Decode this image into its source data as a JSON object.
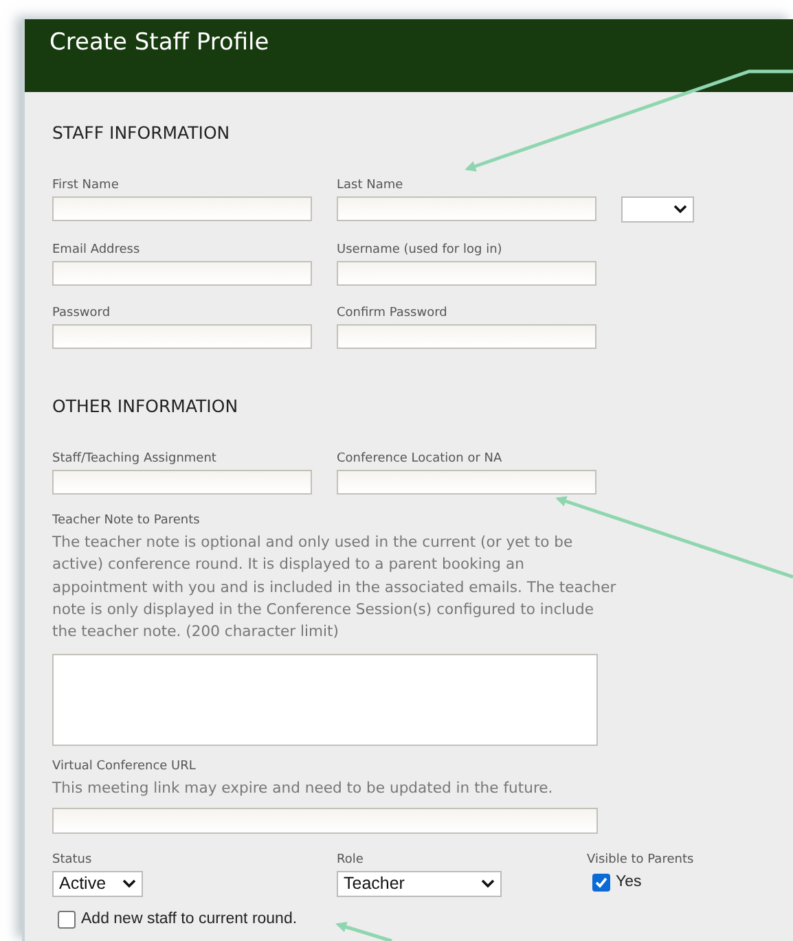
{
  "title": "Create Staff Profile",
  "staff_information": {
    "heading": "STAFF INFORMATION",
    "rows": [
      [
        {
          "kind": "text",
          "label": "First Name"
        },
        {
          "kind": "text",
          "label": "Last Name"
        },
        {
          "kind": "select"
        }
      ],
      [
        {
          "kind": "text",
          "label": "Email Address"
        },
        {
          "kind": "text",
          "label": "Username (used for log in)"
        }
      ],
      [
        {
          "kind": "text",
          "label": "Password"
        },
        {
          "kind": "text",
          "label": "Confirm Password"
        }
      ]
    ]
  },
  "other_information": {
    "heading": "OTHER INFORMATION",
    "rows": [
      [
        {
          "kind": "text",
          "label": "Staff/Teaching Assignment"
        },
        {
          "kind": "text",
          "label": "Conference Location or NA"
        }
      ]
    ],
    "teacher_note": {
      "label": "Teacher Note to Parents",
      "help": "The teacher note is optional and only used in the current (or yet to be active) conference round. It is displayed to a parent booking an appointment with you and is included in the associated emails. The teacher note is only displayed in the Conference Session(s) configured to include the teacher note. (200 character limit)"
    },
    "virtual_url": {
      "label": "Virtual Conference URL",
      "help": "This meeting link may expire and need to be updated in the future."
    },
    "status": {
      "label": "Status",
      "value": "Active"
    },
    "role": {
      "label": "Role",
      "value": "Teacher"
    },
    "visible": {
      "label": "Visible to Parents",
      "option": "Yes",
      "checked": true
    },
    "add_to_round": {
      "label": "Add new staff to current round.",
      "checked": false
    }
  }
}
